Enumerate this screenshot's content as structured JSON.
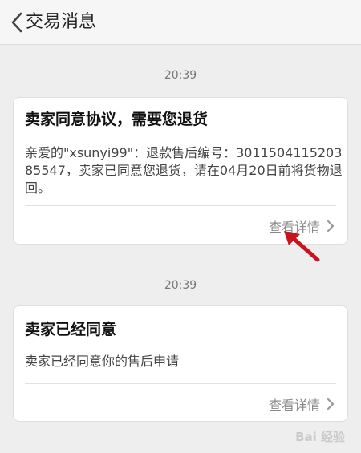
{
  "header": {
    "title": "交易消息"
  },
  "messages": [
    {
      "time": "20:39",
      "title": "卖家同意协议，需要您退货",
      "body": "亲爱的\"xsunyi99\"：退款售后编号：301150411520385547，卖家已同意您退货，请在04月20日前将货物退回。",
      "link_label": "查看详情"
    },
    {
      "time": "20:39",
      "title": "卖家已经同意",
      "body": "卖家已经同意你的售后申请",
      "link_label": "查看详情"
    }
  ],
  "watermark": "Bai 经验",
  "colors": {
    "annotation_arrow": "#c8141e",
    "background": "#eeeeee",
    "card": "#ffffff"
  }
}
